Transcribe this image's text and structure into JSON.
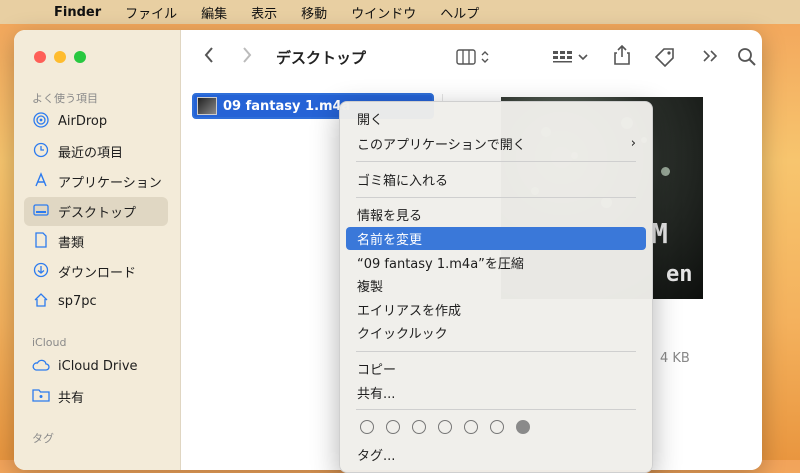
{
  "menubar": {
    "app": "Finder",
    "items": [
      "ファイル",
      "編集",
      "表示",
      "移動",
      "ウインドウ",
      "ヘルプ"
    ]
  },
  "sidebar": {
    "favorites_title": "よく使う項目",
    "favorites": [
      {
        "label": "AirDrop",
        "icon": "airdrop-icon"
      },
      {
        "label": "最近の項目",
        "icon": "clock-icon"
      },
      {
        "label": "アプリケーション",
        "icon": "applications-icon"
      },
      {
        "label": "デスクトップ",
        "icon": "desktop-icon"
      },
      {
        "label": "書類",
        "icon": "document-icon"
      },
      {
        "label": "ダウンロード",
        "icon": "download-icon"
      },
      {
        "label": "sp7pc",
        "icon": "home-icon"
      }
    ],
    "icloud_title": "iCloud",
    "icloud": [
      {
        "label": "iCloud Drive",
        "icon": "cloud-icon"
      },
      {
        "label": "共有",
        "icon": "shared-folder-icon"
      }
    ],
    "tags_title": "タグ"
  },
  "toolbar": {
    "title": "デスクトップ"
  },
  "file": {
    "name": "09 fantasy 1.m4a"
  },
  "preview": {
    "size_fragment": "4 KB"
  },
  "context_menu": {
    "items": [
      {
        "label": "開く"
      },
      {
        "label": "このアプリケーションで開く"
      },
      {
        "label": "ゴミ箱に入れる"
      },
      {
        "label": "情報を見る"
      },
      {
        "label": "名前を変更"
      },
      {
        "label": "“09 fantasy 1.m4a”を圧縮"
      },
      {
        "label": "複製"
      },
      {
        "label": "エイリアスを作成"
      },
      {
        "label": "クイックルック"
      },
      {
        "label": "コピー"
      },
      {
        "label": "共有..."
      },
      {
        "label": "タグ..."
      }
    ],
    "highlighted": "名前を変更",
    "colors": {
      "highlight": "#3a78d9"
    }
  }
}
